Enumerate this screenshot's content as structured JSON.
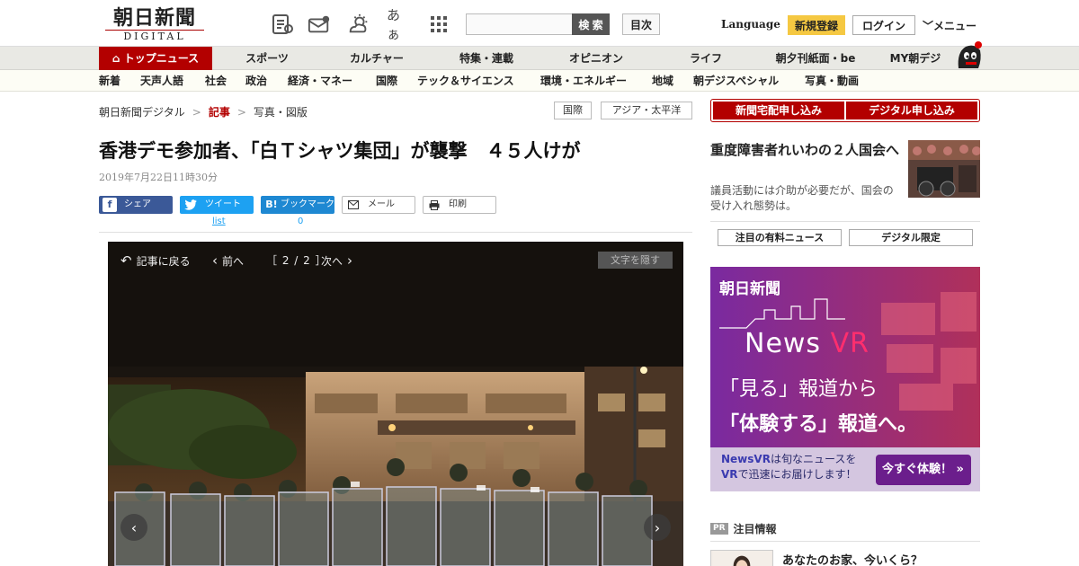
{
  "header": {
    "logo_jp": "朝日新聞",
    "logo_en": "DIGITAL",
    "font_toggle": "あぁ",
    "search_button": "検 索",
    "index_button": "目次",
    "language": "Language",
    "register": "新規登録",
    "login": "ログイン",
    "menu": "メニュー"
  },
  "nav_main": [
    "トップニュース",
    "スポーツ",
    "カルチャー",
    "特集・連載",
    "オピニオン",
    "ライフ",
    "朝夕刊紙面・be",
    "MY朝デジ"
  ],
  "nav_sub": [
    "新着",
    "天声人語",
    "社会",
    "政治",
    "経済・マネー",
    "国際",
    "テック＆サイエンス",
    "環境・エネルギー",
    "地域",
    "朝デジスペシャル",
    "写真・動画"
  ],
  "breadcrumb": [
    "朝日新聞デジタル",
    "記事",
    "写真・図版"
  ],
  "tags": [
    "国際",
    "アジア・太平洋"
  ],
  "article": {
    "headline": "香港デモ参加者、「白Ｔシャツ集団」が襲撃　４５人けが",
    "date": "2019年7月22日11時30分"
  },
  "share": {
    "facebook": "シェア",
    "twitter": "ツイート",
    "twitter_count": "list",
    "hatena": "ブックマーク",
    "hatena_count": "0",
    "mail": "メール",
    "print": "印刷"
  },
  "viewer": {
    "back": "記事に戻る",
    "prev": "前へ",
    "page": "［ 2 / 2 ］",
    "next": "次へ",
    "hide_text": "文字を隠す"
  },
  "sidebar": {
    "subscribe_paper": "新聞宅配申し込み",
    "subscribe_digital": "デジタル申し込み",
    "story_title": "重度障害者れいわの２人国会へ",
    "story_desc": "議員活動には介助が必要だが、国会の受け入れ態勢は。",
    "tab_premium": "注目の有料ニュース",
    "tab_digital": "デジタル限定"
  },
  "ad": {
    "logo": "朝日新聞",
    "news": "News",
    "vr": "VR",
    "line1": "「見る」報道から",
    "line2": "「体験する」報道へ。",
    "bottom_text_1": "NewsVR",
    "bottom_text_2": "は旬なニュースを",
    "bottom_text_3": "VR",
    "bottom_text_4": "で迅速にお届けします！",
    "cta": "今すぐ体験！"
  },
  "pr": {
    "badge": "PR",
    "heading": "注目情報",
    "item_title": "あなたのお家、今いくら？"
  },
  "colors": {
    "brand_red": "#b30000",
    "twitter": "#1da1f2",
    "facebook": "#3b5998",
    "ad_purple": "#6d1e8c"
  }
}
